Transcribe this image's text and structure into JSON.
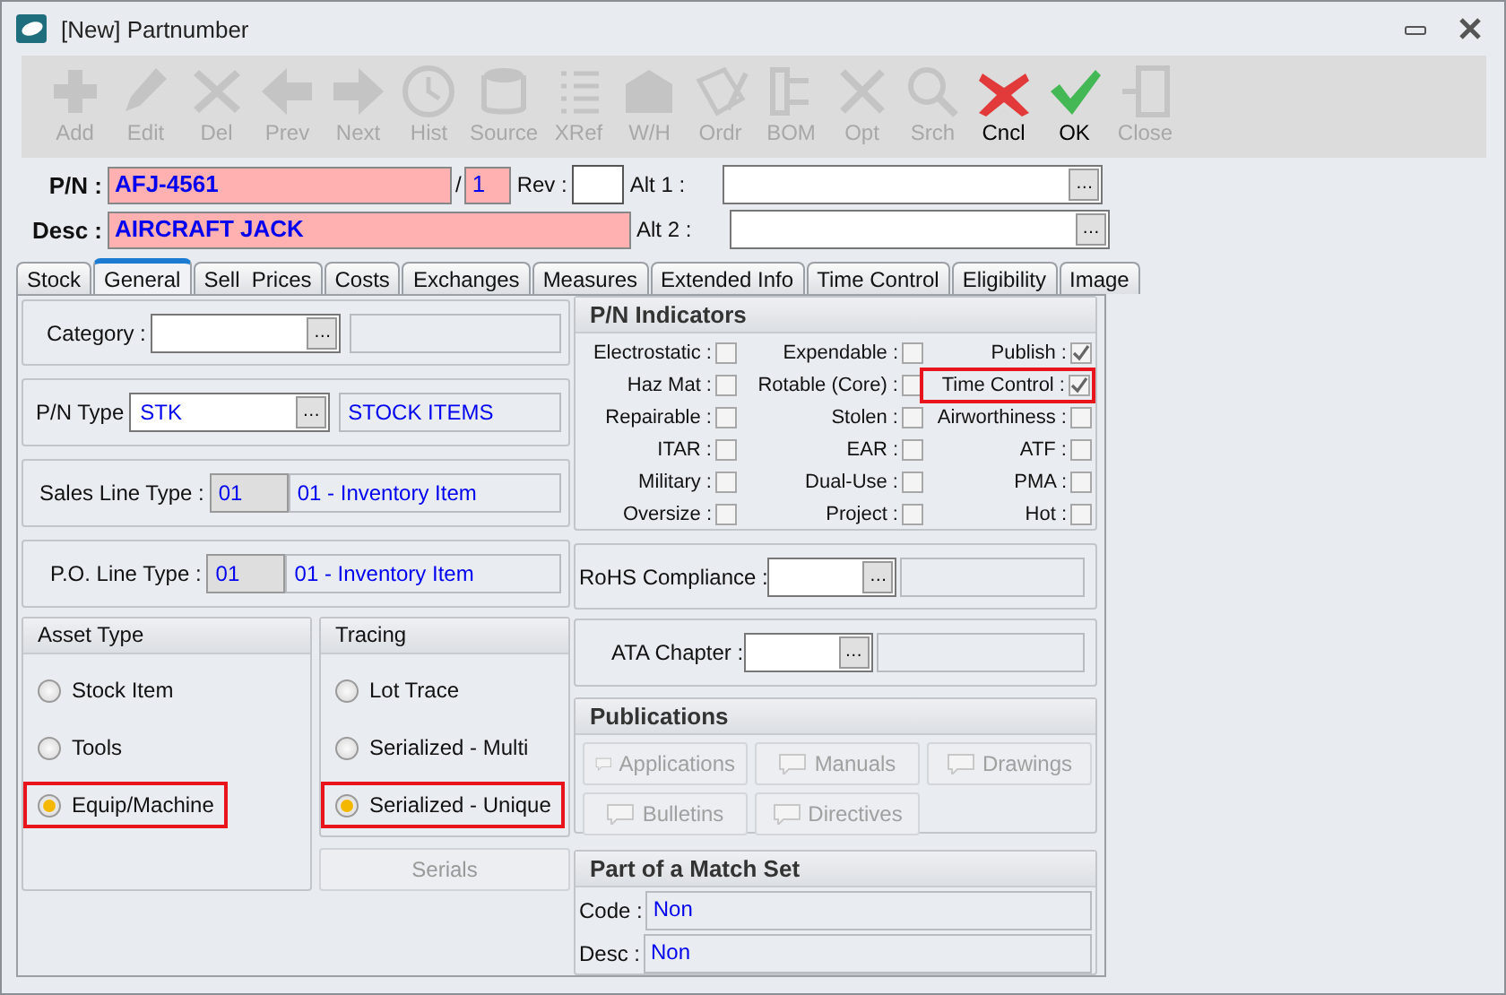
{
  "window": {
    "title": "[New] Partnumber"
  },
  "toolbar": [
    {
      "label": "Add",
      "kind": "add",
      "enabled": false
    },
    {
      "label": "Edit",
      "kind": "edit",
      "enabled": false
    },
    {
      "label": "Del",
      "kind": "delete",
      "enabled": false
    },
    {
      "label": "Prev",
      "kind": "prev",
      "enabled": false
    },
    {
      "label": "Next",
      "kind": "next",
      "enabled": false
    },
    {
      "label": "Hist",
      "kind": "history",
      "enabled": false
    },
    {
      "label": "Source",
      "kind": "source",
      "enabled": false
    },
    {
      "label": "XRef",
      "kind": "xref",
      "enabled": false
    },
    {
      "label": "W/H",
      "kind": "warehouse",
      "enabled": false
    },
    {
      "label": "Ordr",
      "kind": "order",
      "enabled": false
    },
    {
      "label": "BOM",
      "kind": "bom",
      "enabled": false
    },
    {
      "label": "Opt",
      "kind": "options",
      "enabled": false
    },
    {
      "label": "Srch",
      "kind": "search",
      "enabled": false
    },
    {
      "label": "Cncl",
      "kind": "cancel",
      "enabled": true
    },
    {
      "label": "OK",
      "kind": "ok",
      "enabled": true
    },
    {
      "label": "Close",
      "kind": "close",
      "enabled": false
    }
  ],
  "header": {
    "pn": {
      "label": "P/N :",
      "value": "AFJ-4561"
    },
    "separator": "/",
    "suffix": "1",
    "rev": {
      "label": "Rev :"
    },
    "alt1": {
      "label": "Alt 1 :",
      "browse": "…"
    },
    "desc": {
      "label": "Desc :",
      "value": "AIRCRAFT JACK"
    },
    "alt2": {
      "label": "Alt 2 :",
      "browse": "…"
    }
  },
  "tabs": [
    {
      "label": "Stock",
      "selected": false
    },
    {
      "label": "General",
      "selected": true
    },
    {
      "label": "Sell  Prices",
      "selected": false
    },
    {
      "label": "Costs",
      "selected": false
    },
    {
      "label": "Exchanges",
      "selected": false
    },
    {
      "label": "Measures",
      "selected": false
    },
    {
      "label": "Extended Info",
      "selected": false
    },
    {
      "label": "Time Control",
      "selected": false
    },
    {
      "label": "Eligibility",
      "selected": false
    },
    {
      "label": "Image",
      "selected": false
    }
  ],
  "general": {
    "category": {
      "label": "Category :",
      "browse": "…"
    },
    "pn_type": {
      "label": "P/N Type",
      "value": "STK",
      "browse": "…",
      "description": "STOCK ITEMS"
    },
    "sales_line_type": {
      "label": "Sales Line Type :",
      "code": "01",
      "description": "01 - Inventory Item"
    },
    "po_line_type": {
      "label": "P.O. Line Type :",
      "code": "01",
      "description": "01 - Inventory Item"
    },
    "asset_type": {
      "title": "Asset Type",
      "options": [
        {
          "label": "Stock Item",
          "selected": false,
          "highlighted": false
        },
        {
          "label": "Tools",
          "selected": false,
          "highlighted": false
        },
        {
          "label": "Equip/Machine",
          "selected": true,
          "highlighted": true
        }
      ]
    },
    "tracing": {
      "title": "Tracing",
      "options": [
        {
          "label": "Lot Trace",
          "selected": false,
          "highlighted": false
        },
        {
          "label": "Serialized - Multi",
          "selected": false,
          "highlighted": false
        },
        {
          "label": "Serialized - Unique",
          "selected": true,
          "highlighted": true
        }
      ]
    },
    "serials_button": "Serials",
    "indicators": {
      "title": "P/N Indicators",
      "items": [
        {
          "label": "Electrostatic :",
          "checked": false,
          "highlighted": false
        },
        {
          "label": "Expendable :",
          "checked": false,
          "highlighted": false
        },
        {
          "label": "Publish :",
          "checked": true,
          "highlighted": false
        },
        {
          "label": "Haz Mat :",
          "checked": false,
          "highlighted": false
        },
        {
          "label": "Rotable (Core) :",
          "checked": false,
          "highlighted": false
        },
        {
          "label": "Time Control :",
          "checked": true,
          "highlighted": true
        },
        {
          "label": "Repairable :",
          "checked": false,
          "highlighted": false
        },
        {
          "label": "Stolen :",
          "checked": false,
          "highlighted": false
        },
        {
          "label": "Airworthiness :",
          "checked": false,
          "highlighted": false
        },
        {
          "label": "ITAR :",
          "checked": false,
          "highlighted": false
        },
        {
          "label": "EAR :",
          "checked": false,
          "highlighted": false
        },
        {
          "label": "ATF :",
          "checked": false,
          "highlighted": false
        },
        {
          "label": "Military :",
          "checked": false,
          "highlighted": false
        },
        {
          "label": "Dual-Use :",
          "checked": false,
          "highlighted": false
        },
        {
          "label": "PMA :",
          "checked": false,
          "highlighted": false
        },
        {
          "label": "Oversize :",
          "checked": false,
          "highlighted": false
        },
        {
          "label": "Project :",
          "checked": false,
          "highlighted": false
        },
        {
          "label": "Hot :",
          "checked": false,
          "highlighted": false
        }
      ]
    },
    "rohs": {
      "label": "RoHS Compliance :",
      "browse": "…"
    },
    "ata_chapter": {
      "label": "ATA Chapter :",
      "browse": "…"
    },
    "publications": {
      "title": "Publications",
      "buttons": [
        "Applications",
        "Manuals",
        "Drawings",
        "Bulletins",
        "Directives"
      ]
    },
    "match_set": {
      "title": "Part of a Match Set",
      "fields": [
        {
          "label": "Code :",
          "value": "Non"
        },
        {
          "label": "Desc :",
          "value": "Non"
        }
      ]
    }
  }
}
